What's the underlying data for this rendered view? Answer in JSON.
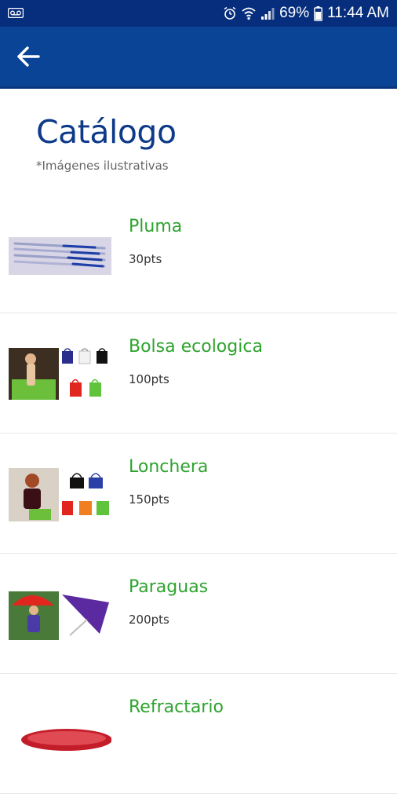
{
  "status_bar": {
    "battery_percent": "69%",
    "time": "11:44 AM",
    "icons": [
      "voicemail-icon",
      "alarm-icon",
      "wifi-icon",
      "signal-icon",
      "battery-icon"
    ]
  },
  "app_bar": {
    "back_icon": "arrow-left-icon",
    "background_color": "#0a4496"
  },
  "header": {
    "title": "Catálogo",
    "subtitle": "*Imágenes ilustrativas"
  },
  "catalog": {
    "items": [
      {
        "name": "Pluma",
        "points": "30pts",
        "image": "pens-image"
      },
      {
        "name": "Bolsa ecologica",
        "points": "100pts",
        "image": "eco-bags-image"
      },
      {
        "name": "Lonchera",
        "points": "150pts",
        "image": "lunch-bags-image"
      },
      {
        "name": "Paraguas",
        "points": "200pts",
        "image": "umbrella-image"
      },
      {
        "name": "Refractario",
        "points": "",
        "image": "refractory-dish-image"
      }
    ]
  },
  "colors": {
    "status_bar": "#062e7d",
    "title": "#0e3a8a",
    "item_name": "#2ea32e"
  }
}
